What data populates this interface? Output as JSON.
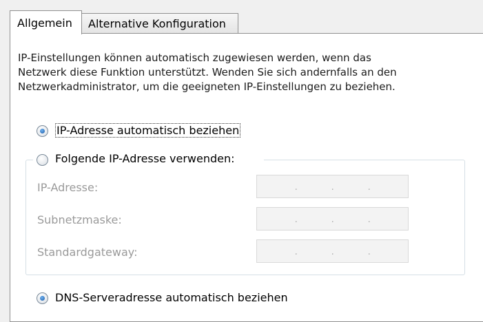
{
  "tabs": {
    "general_label": "Allgemein",
    "alternate_label": "Alternative Konfiguration"
  },
  "description": "IP-Einstellungen können automatisch zugewiesen werden, wenn das Netzwerk diese Funktion unterstützt. Wenden Sie sich andernfalls an den Netzwerkadministrator, um die geeigneten IP-Einstellungen zu beziehen.",
  "ip_options": {
    "auto_label": "IP-Adresse automatisch beziehen",
    "auto_checked": true,
    "manual_label": "Folgende IP-Adresse verwenden:",
    "manual_checked": false
  },
  "fields": {
    "ip_address": {
      "label": "IP-Adresse:",
      "value": "",
      "separator": "."
    },
    "subnet_mask": {
      "label": "Subnetzmaske:",
      "value": "",
      "separator": "."
    },
    "default_gateway": {
      "label": "Standardgateway:",
      "value": "",
      "separator": "."
    }
  },
  "dns_options": {
    "auto_label": "DNS-Serveradresse automatisch beziehen",
    "auto_checked": true
  },
  "colors": {
    "accent": "#1c5aa6",
    "disabled_text": "#9a9a9a",
    "border": "#8f8f8f"
  }
}
